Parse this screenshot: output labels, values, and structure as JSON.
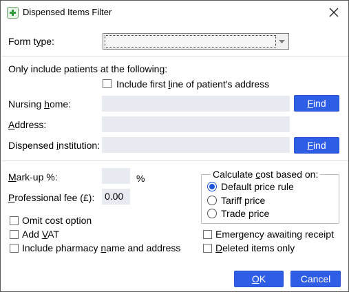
{
  "window": {
    "title": "Dispensed Items Filter",
    "close_icon": "close-icon",
    "app_icon": "pharmacy-cross-icon"
  },
  "form_type": {
    "label_before": "Form t",
    "label_u": "y",
    "label_after": "pe:",
    "value": ""
  },
  "patients": {
    "heading": "Only include patients at the following:",
    "include_first_line": {
      "label_before": "Include first ",
      "label_u": "l",
      "label_after": "ine of patient's address",
      "checked": false
    },
    "nursing_home": {
      "label_before": "Nursing ",
      "label_u": "h",
      "label_after": "ome:",
      "value": ""
    },
    "address": {
      "label_u": "A",
      "label_after": "ddress:",
      "value": ""
    },
    "dispensed_institution": {
      "label_before": "Dispensed ",
      "label_u": "i",
      "label_after": "nstitution:",
      "value": ""
    },
    "find_label_u": "F",
    "find_label_after": "ind"
  },
  "pricing": {
    "markup": {
      "label_u": "M",
      "label_after": "ark-up %:",
      "value": "",
      "unit": "%"
    },
    "professional_fee": {
      "label_u": "P",
      "label_after": "rofessional fee (£):",
      "value": "0.00"
    },
    "calculate_cost": {
      "title_before": "Calculate ",
      "title_u": "c",
      "title_after": "ost based on:",
      "options": [
        "Default price rule",
        "Tariff price",
        "Trade price"
      ],
      "selected": "Default price rule"
    }
  },
  "options": {
    "omit_cost": {
      "label": "Omit cost option",
      "checked": false
    },
    "add_vat": {
      "label_before": "Add ",
      "label_u": "V",
      "label_after": "AT",
      "checked": false
    },
    "include_pharmacy": {
      "label_before": "Include pharmacy ",
      "label_u": "n",
      "label_after": "ame and address",
      "checked": false
    },
    "emergency": {
      "label": "Emergency awaiting receipt",
      "checked": false
    },
    "deleted_items": {
      "label_u": "D",
      "label_after": "eleted items only",
      "checked": false
    }
  },
  "footer": {
    "ok_u": "O",
    "ok_after": "K",
    "cancel_label": "Cancel"
  },
  "colors": {
    "accent": "#2f5ee6",
    "field_bg": "#e8eaf2"
  }
}
